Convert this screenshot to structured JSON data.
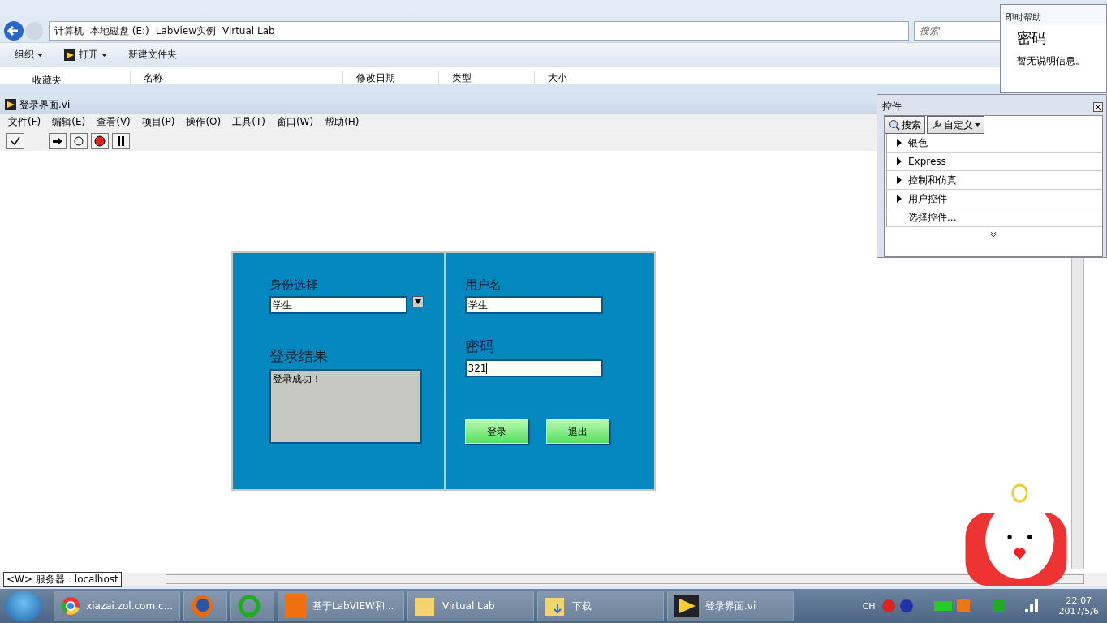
{
  "explorer": {
    "breadcrumb": [
      "计算机",
      "本地磁盘 (E:)",
      "LabView实例",
      "Virtual Lab"
    ],
    "search_placeholder": "搜索",
    "toolbar": [
      {
        "label": "组织",
        "kind": "menu"
      },
      {
        "label": "打开",
        "kind": "open"
      },
      {
        "label": "新建文件夹",
        "kind": "plain"
      }
    ],
    "favorites": "收藏夹",
    "columns": [
      "名称",
      "修改日期",
      "类型",
      "大小"
    ]
  },
  "labview": {
    "title": "登录界面.vi",
    "menu": [
      "文件(F)",
      "编辑(E)",
      "查看(V)",
      "项目(P)",
      "操作(O)",
      "工具(T)",
      "窗口(W)",
      "帮助(H)"
    ],
    "panel": {
      "identity_label": "身份选择",
      "identity_value": "学生",
      "result_label": "登录结果",
      "result_text": "登录成功！",
      "username_label": "用户名",
      "username_value": "学生",
      "password_label": "密码",
      "password_value": "321",
      "buttons": [
        "登录",
        "退出"
      ]
    },
    "status": {
      "context": "<W>",
      "server": "服务器：localhost"
    }
  },
  "help": {
    "title": "即时帮助",
    "heading": "密码",
    "text": "暂无说明信息。"
  },
  "palette": {
    "title": "控件",
    "buttons": [
      {
        "label": "搜索",
        "kind": "search"
      },
      {
        "label": "自定义",
        "kind": "customize"
      }
    ],
    "items": [
      {
        "label": "银色",
        "kind": "category"
      },
      {
        "label": "Express",
        "kind": "category"
      },
      {
        "label": "控制和仿真",
        "kind": "category"
      },
      {
        "label": "用户控件",
        "kind": "category"
      },
      {
        "label": "选择控件...",
        "kind": "action"
      }
    ]
  },
  "taskbar": {
    "items": [
      {
        "label": "xiazai.zol.com.c...",
        "kind": "chrome"
      },
      {
        "kind": "firefox"
      },
      {
        "kind": "green"
      },
      {
        "label": "基于LabVIEW和...",
        "kind": "pdf"
      },
      {
        "label": "Virtual Lab",
        "kind": "folder"
      },
      {
        "label": "下载",
        "kind": "download"
      },
      {
        "label": "登录界面.vi",
        "kind": "labview"
      }
    ],
    "lang": "CH",
    "time": "22:07",
    "date": "2017/5/6"
  }
}
